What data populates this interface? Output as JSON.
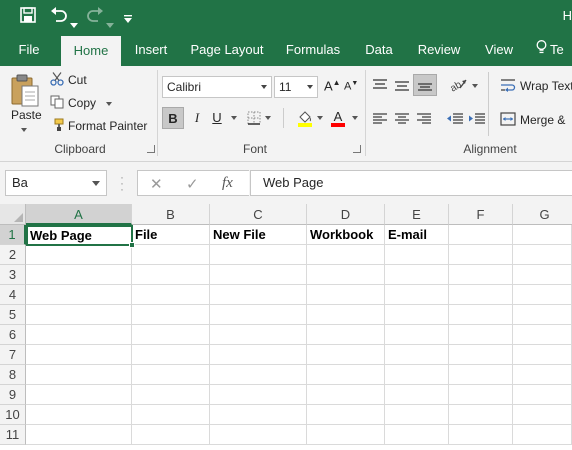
{
  "quick_access": {
    "save_icon": "save-icon",
    "undo_icon": "undo-icon",
    "redo_icon": "redo-icon",
    "customize_icon": "customize-icon"
  },
  "window": {
    "title_partial": "H"
  },
  "tabs": [
    {
      "label": "File"
    },
    {
      "label": "Home"
    },
    {
      "label": "Insert"
    },
    {
      "label": "Page Layout"
    },
    {
      "label": "Formulas"
    },
    {
      "label": "Data"
    },
    {
      "label": "Review"
    },
    {
      "label": "View"
    },
    {
      "label": "Te"
    }
  ],
  "clipboard": {
    "paste_label": "Paste",
    "cut_label": "Cut",
    "copy_label": "Copy",
    "format_painter_label": "Format Painter",
    "group_label": "Clipboard"
  },
  "font": {
    "family": "Calibri",
    "size": "11",
    "bold_label": "B",
    "italic_label": "I",
    "underline_label": "U",
    "group_label": "Font",
    "fill_color": "#FFFF00",
    "font_color": "#FF0000"
  },
  "alignment": {
    "wrap_text_label": "Wrap Text",
    "merge_label": "Merge &",
    "group_label": "Alignment"
  },
  "formula_bar": {
    "name_box": "Ba",
    "fx_label": "fx",
    "formula": "Web Page"
  },
  "columns": [
    "A",
    "B",
    "C",
    "D",
    "E",
    "F",
    "G"
  ],
  "rows": [
    "1",
    "2",
    "3",
    "4",
    "5",
    "6",
    "7",
    "8",
    "9",
    "10",
    "11"
  ],
  "cells": {
    "A1": "Web Page",
    "B1": "File",
    "C1": "New File",
    "D1": "Workbook",
    "E1": "E-mail"
  },
  "accent_color": "#217346"
}
